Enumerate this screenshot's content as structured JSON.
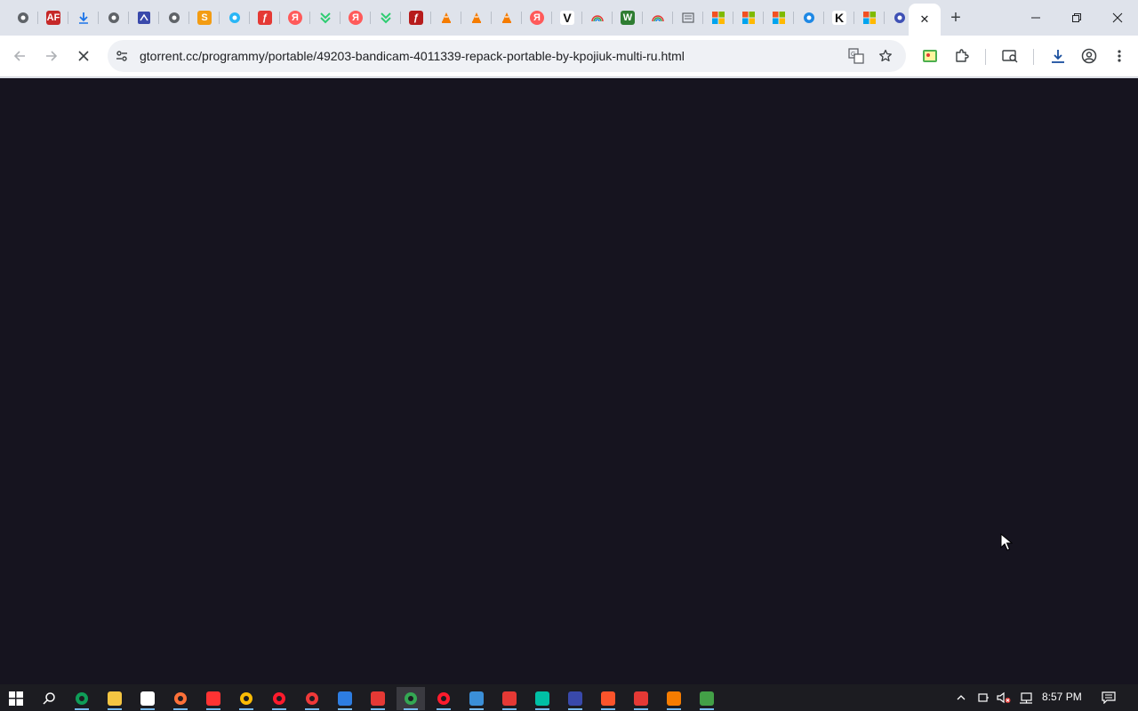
{
  "browser": {
    "tabs": [
      {
        "icon": "chrome-icon",
        "glyph": "",
        "color": "#5f6368"
      },
      {
        "icon": "af-icon",
        "glyph": "AF",
        "color": "#c62828"
      },
      {
        "icon": "download-arrow-icon",
        "glyph": "",
        "color": "#1a73e8"
      },
      {
        "icon": "globe-icon",
        "glyph": "",
        "color": "#5f6368"
      },
      {
        "icon": "puzzle-app-icon",
        "glyph": "",
        "color": "#3949ab"
      },
      {
        "icon": "globe-icon",
        "glyph": "",
        "color": "#5f6368"
      },
      {
        "icon": "orange-s-icon",
        "glyph": "S",
        "color": "#f39c12"
      },
      {
        "icon": "blue-circle-icon",
        "glyph": "",
        "color": "#29b6f6"
      },
      {
        "icon": "flash-red-icon",
        "glyph": "ƒ",
        "color": "#e53935"
      },
      {
        "icon": "yandex-icon",
        "glyph": "Я",
        "color": "#ff5a5a"
      },
      {
        "icon": "uptodown-icon",
        "glyph": "",
        "color": "#2ecc71"
      },
      {
        "icon": "yandex-icon",
        "glyph": "Я",
        "color": "#ff5a5a"
      },
      {
        "icon": "uptodown-icon",
        "glyph": "",
        "color": "#2ecc71"
      },
      {
        "icon": "flash-player-icon",
        "glyph": "ƒ",
        "color": "#b71c1c"
      },
      {
        "icon": "vlc-icon",
        "glyph": "",
        "color": "#f57c00"
      },
      {
        "icon": "vlc-icon",
        "glyph": "",
        "color": "#f57c00"
      },
      {
        "icon": "vlc-icon",
        "glyph": "",
        "color": "#f57c00"
      },
      {
        "icon": "yandex-icon",
        "glyph": "Я",
        "color": "#ff5a5a"
      },
      {
        "icon": "v-logo-icon",
        "glyph": "V",
        "color": "#111111"
      },
      {
        "icon": "rainbow-icon",
        "glyph": "",
        "color": "#e65100"
      },
      {
        "icon": "green-w-icon",
        "glyph": "W",
        "color": "#2e7d32"
      },
      {
        "icon": "colorful-star-icon",
        "glyph": "",
        "color": "#8e24aa"
      },
      {
        "icon": "news-icon",
        "glyph": "",
        "color": "#5f6368"
      },
      {
        "icon": "microsoft-icon",
        "glyph": "",
        "color": "#f25022"
      },
      {
        "icon": "microsoft-icon",
        "glyph": "",
        "color": "#f25022"
      },
      {
        "icon": "microsoft-icon",
        "glyph": "",
        "color": "#f25022"
      },
      {
        "icon": "settings-blue-icon",
        "glyph": "",
        "color": "#1e88e5"
      },
      {
        "icon": "k-logo-icon",
        "glyph": "K",
        "color": "#111111"
      },
      {
        "icon": "microsoft-icon",
        "glyph": "",
        "color": "#f25022"
      },
      {
        "icon": "swirl-icon",
        "glyph": "",
        "color": "#3f51b5"
      }
    ],
    "active_tab_close": "✕",
    "new_tab": "+",
    "url": "gtorrent.cc/programmy/portable/49203-bandicam-4011339-repack-portable-by-kpojiuk-multi-ru.html"
  },
  "taskbar": {
    "apps": [
      {
        "icon": "search-icon",
        "color": "#1c1c21"
      },
      {
        "icon": "edge-icon",
        "color": "#0f9d58"
      },
      {
        "icon": "file-explorer-icon",
        "color": "#f4c542"
      },
      {
        "icon": "store-icon",
        "color": "#ffffff"
      },
      {
        "icon": "firefox-icon",
        "color": "#ff7139"
      },
      {
        "icon": "yandex-icon",
        "color": "#ff3333"
      },
      {
        "icon": "chrome-icon",
        "color": "#fbbc05"
      },
      {
        "icon": "opera-icon",
        "color": "#ff1b2d"
      },
      {
        "icon": "vivaldi-icon",
        "color": "#ef3939"
      },
      {
        "icon": "shield-icon",
        "color": "#2d7de2"
      },
      {
        "icon": "camera-icon",
        "color": "#e53935"
      },
      {
        "icon": "chrome-icon",
        "color": "#34a853"
      },
      {
        "icon": "opera-gx-icon",
        "color": "#ff1b2d"
      },
      {
        "icon": "tools-icon",
        "color": "#3b8fd8"
      },
      {
        "icon": "download-manager-icon",
        "color": "#e53935"
      },
      {
        "icon": "play-store-icon",
        "color": "#00bfa5"
      },
      {
        "icon": "castle-icon",
        "color": "#3949ab"
      },
      {
        "icon": "brave-icon",
        "color": "#fb542b"
      },
      {
        "icon": "chart-icon",
        "color": "#e53935"
      },
      {
        "icon": "vlc-icon",
        "color": "#f57c00"
      },
      {
        "icon": "uptodown-icon",
        "color": "#43a047"
      }
    ],
    "clock": "8:57 PM"
  }
}
